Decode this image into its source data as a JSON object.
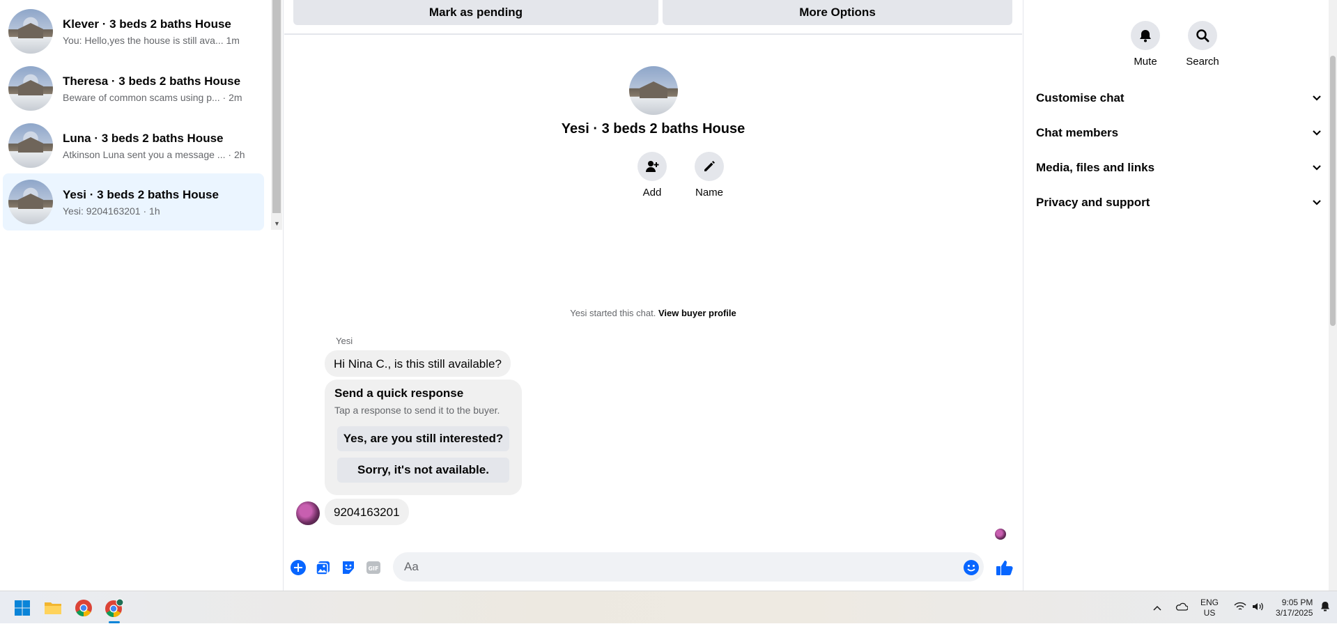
{
  "conversations": [
    {
      "name": "Klever · 3 beds 2 baths House",
      "preview": "You: Hello,yes the house is still ava...",
      "time": "1m"
    },
    {
      "name": "Theresa · 3 beds 2 baths House",
      "preview": "Beware of common scams using p...",
      "time": "2m"
    },
    {
      "name": "Luna · 3 beds 2 baths House",
      "preview": "Atkinson Luna sent you a message ...",
      "time": "2h"
    },
    {
      "name": "Yesi · 3 beds 2 baths House",
      "preview": "Yesi: 9204163201",
      "time": "1h"
    }
  ],
  "top_actions": {
    "mark_pending": "Mark as pending",
    "more_options": "More Options"
  },
  "chat": {
    "title": "Yesi · 3 beds 2 baths House",
    "add_label": "Add",
    "name_label": "Name",
    "started_text": "Yesi started this chat.",
    "view_profile": "View buyer profile",
    "sender": "Yesi",
    "message_1": "Hi Nina C., is this still available?",
    "quick_title": "Send a quick response",
    "quick_sub": "Tap a response to send it to the buyer.",
    "quick_opt_1": "Yes, are you still interested?",
    "quick_opt_2": "Sorry, it's not available.",
    "message_2": "9204163201"
  },
  "composer": {
    "placeholder": "Aa"
  },
  "right_panel": {
    "mute": "Mute",
    "search": "Search",
    "sections": [
      "Customise chat",
      "Chat members",
      "Media, files and links",
      "Privacy and support"
    ]
  },
  "taskbar": {
    "lang_1": "ENG",
    "lang_2": "US",
    "time": "9:05 PM",
    "date": "3/17/2025"
  },
  "colors": {
    "accent": "#0866ff",
    "active_row": "#ebf5ff",
    "bubble": "#f0f0f0"
  }
}
